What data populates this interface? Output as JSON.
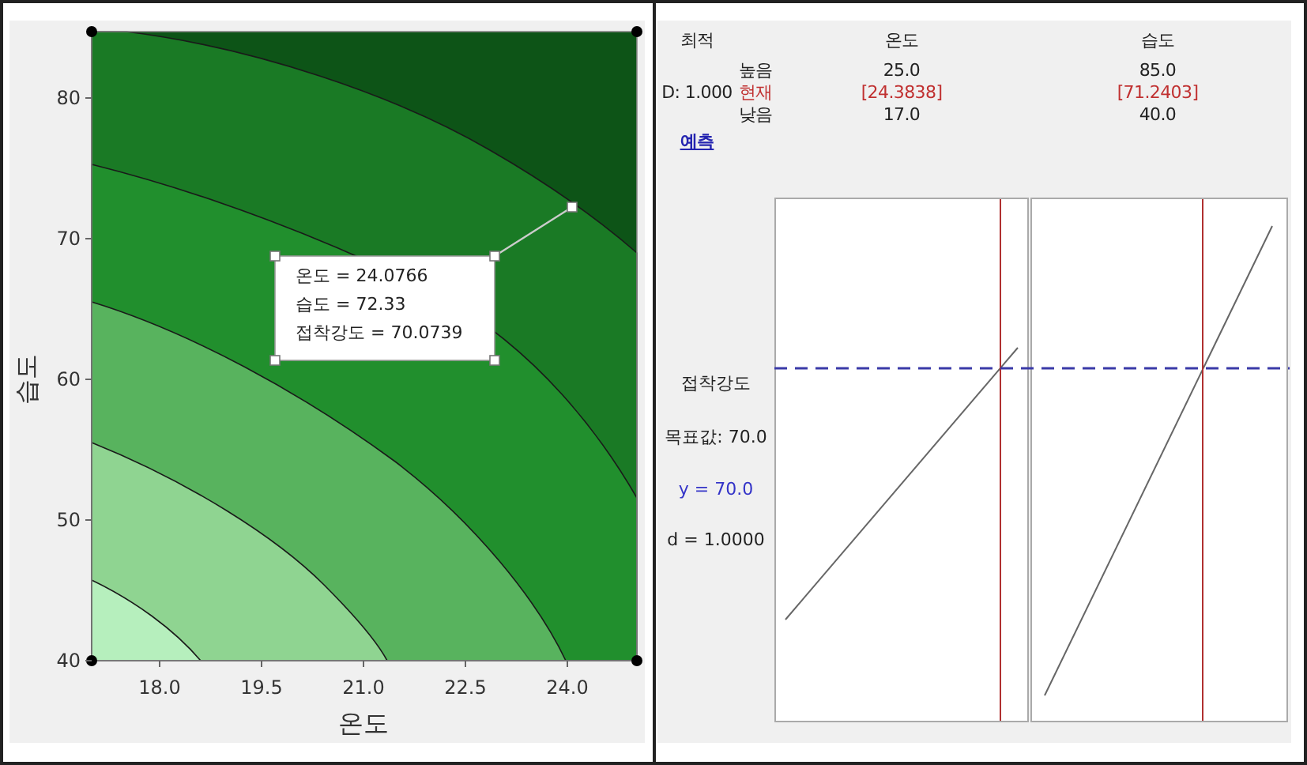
{
  "contour_plot": {
    "xlabel": "온도",
    "ylabel": "습도",
    "xticks": [
      "18.0",
      "19.5",
      "21.0",
      "22.5",
      "24.0"
    ],
    "yticks": [
      "80",
      "70",
      "60",
      "50",
      "40"
    ],
    "tooltip": [
      "온도 = 24.0766",
      "습도 = 72.33",
      "접착강도 = 70.0739"
    ]
  },
  "optimizer": {
    "title": "최적",
    "desirability": "D: 1.000",
    "predict_link": "예측",
    "row_labels": {
      "high": "높음",
      "current": "현재",
      "low": "낮음"
    },
    "factors": [
      {
        "name": "온도",
        "high": "25.0",
        "current": "[24.3838]",
        "low": "17.0"
      },
      {
        "name": "습도",
        "high": "85.0",
        "current": "[71.2403]",
        "low": "40.0"
      }
    ],
    "response": {
      "name": "접착강도",
      "target": "목표값: 70.0",
      "y": "y = 70.0",
      "d": "d = 1.0000"
    }
  }
}
